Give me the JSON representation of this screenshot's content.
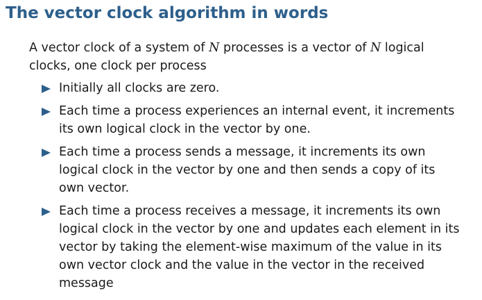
{
  "slide": {
    "title": "The vector clock algorithm in words",
    "intro": {
      "part1": "A vector clock of a system of ",
      "var1": "N",
      "part2": " processes is a vector of ",
      "var2": "N",
      "part3": " logical clocks, one clock per process"
    },
    "bullets": [
      "Initially all clocks are zero.",
      "Each time a process experiences an internal event, it increments its own logical clock in the vector by one.",
      "Each time a process sends a message, it increments its own logical clock in the vector by one and then sends a copy of its own vector.",
      "Each time a process receives a message, it increments its own logical clock in the vector by one and updates each element in its vector by taking the element-wise maximum of the value in its own vector clock and the value in the vector in the received message"
    ],
    "colors": {
      "accent": "#2d5f8b",
      "text": "#1a1a1a",
      "background": "#ffffff"
    },
    "bullet_icon": "triangle-right-icon"
  }
}
